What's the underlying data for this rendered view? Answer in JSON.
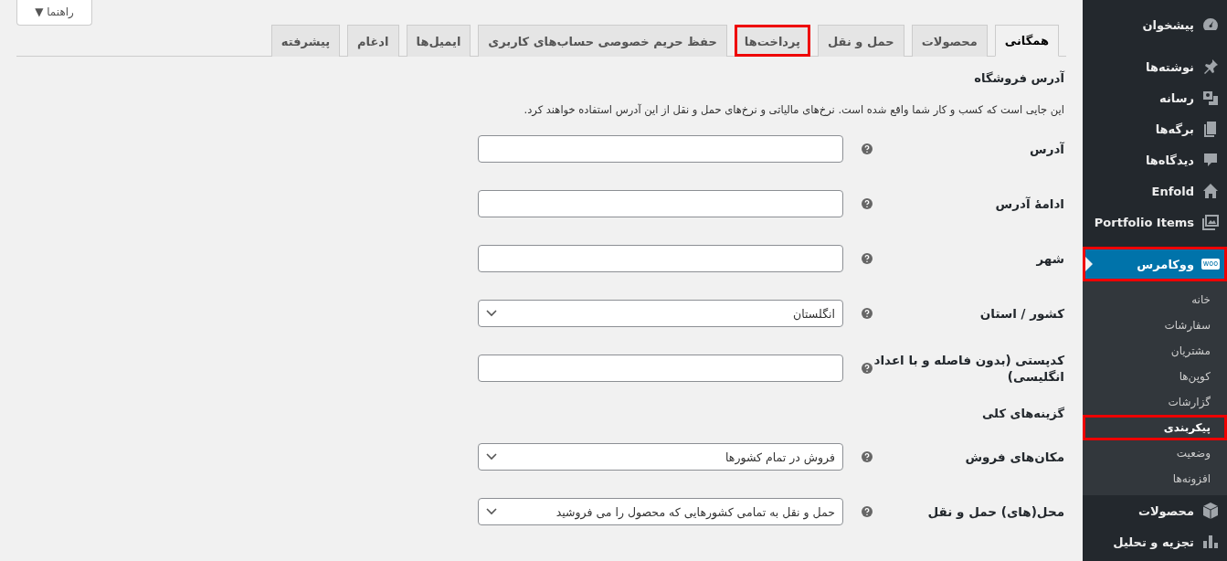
{
  "help_button": {
    "label": "راهنما",
    "caret": "▼"
  },
  "tabs": [
    {
      "label": "همگانی",
      "selected": true,
      "highlighted": false
    },
    {
      "label": "محصولات",
      "selected": false,
      "highlighted": false
    },
    {
      "label": "حمل و نقل",
      "selected": false,
      "highlighted": false
    },
    {
      "label": "پرداخت‌ها",
      "selected": false,
      "highlighted": true
    },
    {
      "label": "حفظ حریم خصوصی حساب‌های کاربری",
      "selected": false,
      "highlighted": false
    },
    {
      "label": "ایمیل‌ها",
      "selected": false,
      "highlighted": false
    },
    {
      "label": "ادغام",
      "selected": false,
      "highlighted": false
    },
    {
      "label": "پیشرفته",
      "selected": false,
      "highlighted": false
    }
  ],
  "sections": [
    {
      "title": "آدرس فروشگاه",
      "description": "این جایی است که کسب و کار شما واقع شده است. نرخ‌های مالیاتی و نرخ‌های حمل و نقل از این آدرس استفاده خواهند کرد.",
      "fields": [
        {
          "label": "آدرس",
          "kind": "text"
        },
        {
          "label": "ادامهٔ آدرس",
          "kind": "text"
        },
        {
          "label": "شهر",
          "kind": "text"
        },
        {
          "label": "کشور / استان",
          "kind": "select",
          "value": "انگلستان"
        },
        {
          "label": "کدپستی (بدون فاصله و با اعداد انگلیسی)",
          "kind": "text"
        }
      ]
    },
    {
      "title": "گزینه‌های کلی",
      "fields": [
        {
          "label": "مکان‌های فروش",
          "kind": "select",
          "value": "فروش در تمام کشورها"
        },
        {
          "label": "محل(های) حمل و نقل",
          "kind": "select",
          "value": "حمل و نقل به تمامی کشورهایی که محصول را می فروشید"
        }
      ]
    }
  ],
  "sidebar": {
    "items": [
      {
        "label": "پیشخوان",
        "kind": "gauge",
        "selected": false,
        "highlighted": false
      },
      {
        "label": "نوشته‌ها",
        "kind": "pin",
        "selected": false,
        "highlighted": false
      },
      {
        "label": "رسانه",
        "kind": "media",
        "selected": false,
        "highlighted": false
      },
      {
        "label": "برگه‌ها",
        "kind": "pages",
        "selected": false,
        "highlighted": false
      },
      {
        "label": "دیدگاه‌ها",
        "kind": "comment",
        "selected": false,
        "highlighted": false
      },
      {
        "label": "Enfold",
        "kind": "home",
        "selected": false,
        "highlighted": false
      },
      {
        "label": "Portfolio Items",
        "kind": "images",
        "selected": false,
        "highlighted": false
      },
      {
        "label": "ووکامرس",
        "kind": "woo",
        "icon_text": "woo",
        "selected": true,
        "highlighted": true,
        "children": [
          {
            "label": "خانه",
            "selected": false,
            "highlighted": false
          },
          {
            "label": "سفارشات",
            "selected": false,
            "highlighted": false
          },
          {
            "label": "مشتریان",
            "selected": false,
            "highlighted": false
          },
          {
            "label": "کوپن‌ها",
            "selected": false,
            "highlighted": false
          },
          {
            "label": "گزارشات",
            "selected": false,
            "highlighted": false
          },
          {
            "label": "پیکربندی",
            "selected": true,
            "highlighted": true
          },
          {
            "label": "وضعیت",
            "selected": false,
            "highlighted": false
          },
          {
            "label": "افزونه‌ها",
            "selected": false,
            "highlighted": false
          }
        ]
      },
      {
        "label": "محصولات",
        "kind": "box",
        "selected": false,
        "highlighted": false
      },
      {
        "label": "تجزیه و تحلیل",
        "kind": "chart",
        "selected": false,
        "highlighted": false
      }
    ]
  }
}
